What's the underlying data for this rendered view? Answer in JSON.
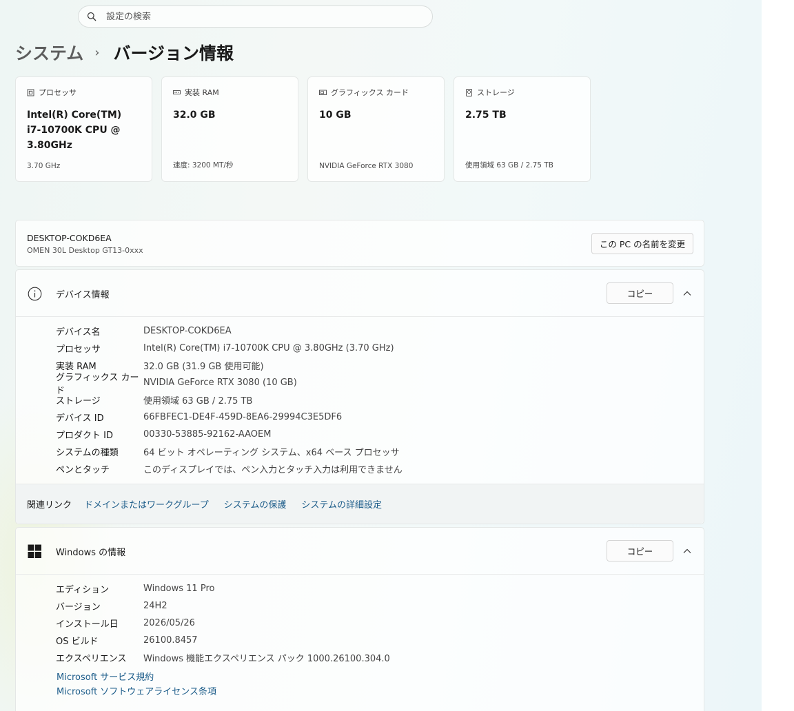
{
  "search": {
    "placeholder": "設定の検索"
  },
  "breadcrumb": {
    "parent": "システム",
    "separator": "›",
    "current": "バージョン情報"
  },
  "spec_cards": [
    {
      "label": "プロセッサ",
      "value": "Intel(R) Core(TM) i7-10700K CPU @ 3.80GHz",
      "sub": "3.70 GHz",
      "icon": "processor-icon"
    },
    {
      "label": "実装 RAM",
      "value": "32.0 GB",
      "sub": "速度: 3200 MT/秒",
      "icon": "ram-icon"
    },
    {
      "label": "グラフィックス カード",
      "value": "10 GB",
      "sub": "NVIDIA GeForce RTX 3080",
      "icon": "gpu-icon"
    },
    {
      "label": "ストレージ",
      "value": "2.75 TB",
      "sub": "使用領域 63 GB / 2.75 TB",
      "icon": "storage-icon"
    }
  ],
  "pc": {
    "name": "DESKTOP-COKD6EA",
    "model": "OMEN 30L Desktop GT13-0xxx",
    "rename_label": "この PC の名前を変更"
  },
  "device_info": {
    "title": "デバイス情報",
    "copy_label": "コピー",
    "rows": [
      {
        "key": "デバイス名",
        "value": "DESKTOP-COKD6EA"
      },
      {
        "key": "プロセッサ",
        "value": "Intel(R) Core(TM) i7-10700K CPU @ 3.80GHz (3.70 GHz)"
      },
      {
        "key": "実装 RAM",
        "value": "32.0 GB (31.9 GB 使用可能)"
      },
      {
        "key": "グラフィックス カード",
        "value": "NVIDIA GeForce RTX 3080 (10 GB)"
      },
      {
        "key": "ストレージ",
        "value": "使用領域 63 GB / 2.75 TB"
      },
      {
        "key": "デバイス ID",
        "value": "66FBFEC1-DE4F-459D-8EA6-29994C3E5DF6"
      },
      {
        "key": "プロダクト ID",
        "value": "00330-53885-92162-AAOEM"
      },
      {
        "key": "システムの種類",
        "value": "64 ビット オペレーティング システム、x64 ベース プロセッサ"
      },
      {
        "key": "ペンとタッチ",
        "value": "このディスプレイでは、ペン入力とタッチ入力は利用できません"
      }
    ]
  },
  "related_links": {
    "label": "関連リンク",
    "links": [
      "ドメインまたはワークグループ",
      "システムの保護",
      "システムの詳細設定"
    ]
  },
  "windows_info": {
    "title": "Windows の情報",
    "copy_label": "コピー",
    "rows": [
      {
        "key": "エディション",
        "value": "Windows 11 Pro"
      },
      {
        "key": "バージョン",
        "value": "24H2"
      },
      {
        "key": "インストール日",
        "value": "2026/05/26"
      },
      {
        "key": "OS ビルド",
        "value": "26100.8457"
      },
      {
        "key": "エクスペリエンス",
        "value": "Windows 機能エクスペリエンス パック 1000.26100.304.0"
      }
    ],
    "links": [
      "Microsoft サービス規約",
      "Microsoft ソフトウェアライセンス条項"
    ]
  },
  "colors": {
    "link": "#1d5d8a",
    "windows_logo": "#1a1a1a"
  }
}
